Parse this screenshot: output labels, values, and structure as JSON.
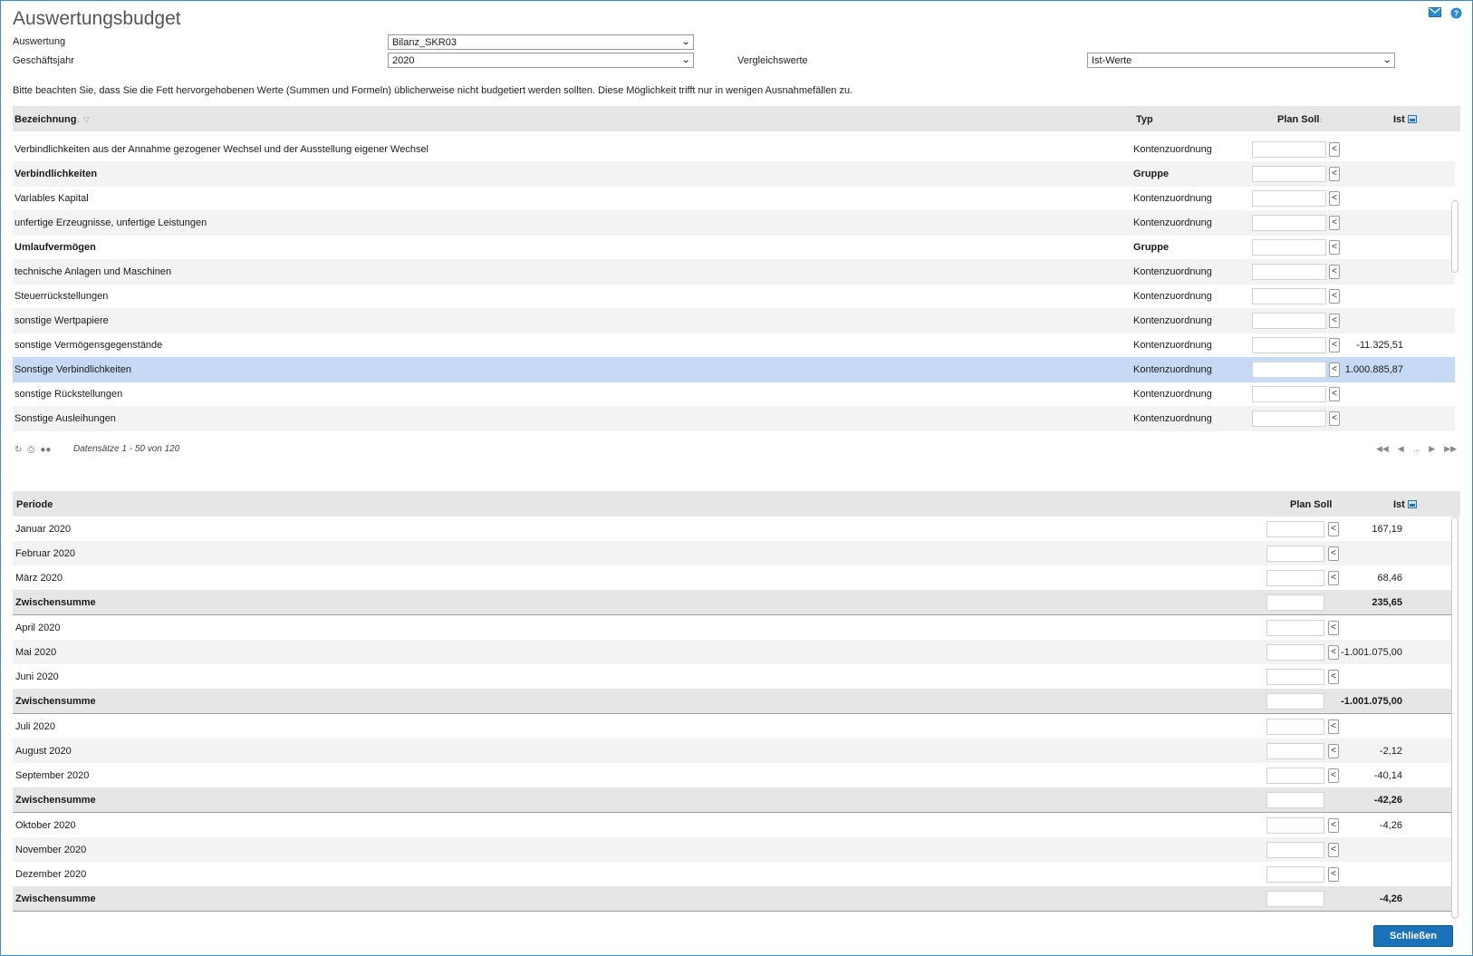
{
  "title": "Auswertungsbudget",
  "form": {
    "auswertung_label": "Auswertung",
    "auswertung_value": "Bilanz_SKR03",
    "jahr_label": "Geschäftsjahr",
    "jahr_value": "2020",
    "vergleich_label": "Vergleichswerte",
    "vergleich_value": "Ist-Werte"
  },
  "note": "Bitte beachten Sie, dass Sie die Fett hervorgehobenen Werte (Summen und Formeln) üblicherweise nicht budgetiert werden sollten. Diese Möglichkeit trifft nur in wenigen Ausnahmefällen zu.",
  "grid1": {
    "headers": {
      "bezeichnung": "Bezeichnung",
      "typ": "Typ",
      "plan": "Plan Soll",
      "ist": "Ist"
    },
    "rows": [
      {
        "name": "Verbindlichkeiten aus der Annahme gezogener Wechsel und der Ausstellung eigener Wechsel",
        "typ": "Kontenzuordnung",
        "ist": "",
        "bold": false
      },
      {
        "name": "Verbindlichkeiten",
        "typ": "Gruppe",
        "ist": "",
        "bold": true
      },
      {
        "name": "Variables Kapital",
        "typ": "Kontenzuordnung",
        "ist": "",
        "bold": false
      },
      {
        "name": "unfertige Erzeugnisse, unfertige Leistungen",
        "typ": "Kontenzuordnung",
        "ist": "",
        "bold": false
      },
      {
        "name": "Umlaufvermögen",
        "typ": "Gruppe",
        "ist": "",
        "bold": true
      },
      {
        "name": "technische Anlagen und Maschinen",
        "typ": "Kontenzuordnung",
        "ist": "",
        "bold": false
      },
      {
        "name": "Steuerrückstellungen",
        "typ": "Kontenzuordnung",
        "ist": "",
        "bold": false
      },
      {
        "name": "sonstige Wertpapiere",
        "typ": "Kontenzuordnung",
        "ist": "",
        "bold": false
      },
      {
        "name": "sonstige Vermögensgegenstände",
        "typ": "Kontenzuordnung",
        "ist": "-11.325,51",
        "bold": false
      },
      {
        "name": "Sonstige Verbindlichkeiten",
        "typ": "Kontenzuordnung",
        "ist": "1.000.885,87",
        "bold": false,
        "selected": true
      },
      {
        "name": "sonstige Rückstellungen",
        "typ": "Kontenzuordnung",
        "ist": "",
        "bold": false
      },
      {
        "name": "Sonstige Ausleihungen",
        "typ": "Kontenzuordnung",
        "ist": "",
        "bold": false
      }
    ],
    "footer_info": "Datensätze 1 - 50 von 120",
    "pager_ellipsis": "..."
  },
  "grid2": {
    "headers": {
      "periode": "Periode",
      "plan": "Plan Soll",
      "ist": "Ist"
    },
    "rows": [
      {
        "name": "Januar 2020",
        "ist": "167,19",
        "sub": false
      },
      {
        "name": "Februar 2020",
        "ist": "",
        "sub": false
      },
      {
        "name": "März 2020",
        "ist": "68,46",
        "sub": false
      },
      {
        "name": "Zwischensumme",
        "ist": "235,65",
        "sub": true
      },
      {
        "name": "April 2020",
        "ist": "",
        "sub": false
      },
      {
        "name": "Mai 2020",
        "ist": "-1.001.075,00",
        "sub": false
      },
      {
        "name": "Juni 2020",
        "ist": "",
        "sub": false
      },
      {
        "name": "Zwischensumme",
        "ist": "-1.001.075,00",
        "sub": true
      },
      {
        "name": "Juli 2020",
        "ist": "",
        "sub": false
      },
      {
        "name": "August 2020",
        "ist": "-2,12",
        "sub": false
      },
      {
        "name": "September 2020",
        "ist": "-40,14",
        "sub": false
      },
      {
        "name": "Zwischensumme",
        "ist": "-42,26",
        "sub": true
      },
      {
        "name": "Oktober 2020",
        "ist": "-4,26",
        "sub": false
      },
      {
        "name": "November 2020",
        "ist": "",
        "sub": false
      },
      {
        "name": "Dezember 2020",
        "ist": "",
        "sub": false
      },
      {
        "name": "Zwischensumme",
        "ist": "-4,26",
        "sub": true
      }
    ]
  },
  "buttons": {
    "close": "Schließen"
  },
  "icons": [
    "mail-icon",
    "help-icon",
    "refresh-icon",
    "print-icon",
    "columns-icon",
    "export-icon",
    "sort-icon",
    "filter-icon"
  ],
  "colors": {
    "accent": "#1a73b8",
    "selected_row": "#c6daf6",
    "header_bg": "#e6e6e6"
  }
}
